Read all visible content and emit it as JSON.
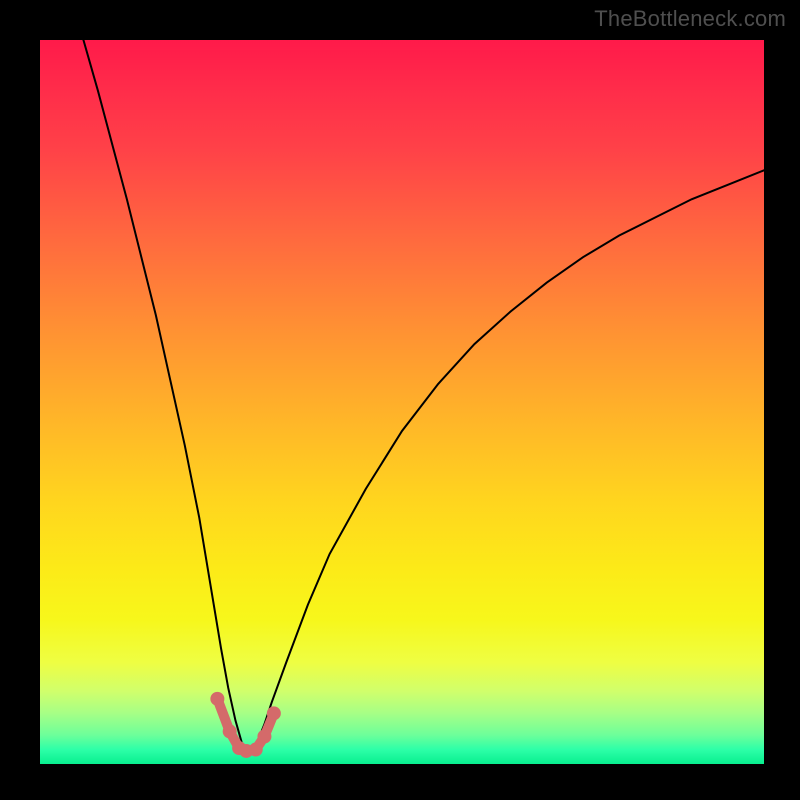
{
  "watermark": "TheBottleneck.com",
  "colors": {
    "frame": "#000000",
    "watermark_text": "#4f4f4f",
    "curve_stroke": "#000000",
    "dot_fill": "#d46a6a",
    "gradient_stops": [
      "#ff1a4a",
      "#ff2a4a",
      "#ff4148",
      "#ff6b3e",
      "#ff9133",
      "#ffb728",
      "#ffd61e",
      "#fcea18",
      "#f7f71b",
      "#eefe43",
      "#d0ff6c",
      "#a6ff86",
      "#6dff9a",
      "#2dffa8",
      "#08ef8f"
    ]
  },
  "chart_data": {
    "type": "line",
    "title": "",
    "xlabel": "",
    "ylabel": "",
    "xlim": [
      0,
      100
    ],
    "ylim": [
      0,
      100
    ],
    "grid": false,
    "legend": false,
    "description": "V-shaped bottleneck curve with minimum near x≈28; steep left rise, gentler right rise. Background vertical gradient encodes severity (red=high, green=low).",
    "series": [
      {
        "name": "bottleneck-curve",
        "x": [
          6,
          8,
          10,
          12,
          14,
          16,
          18,
          20,
          22,
          24,
          25,
          26,
          27,
          28,
          29,
          30,
          31,
          32,
          34,
          37,
          40,
          45,
          50,
          55,
          60,
          65,
          70,
          75,
          80,
          85,
          90,
          95,
          100
        ],
        "y": [
          100,
          93,
          85.5,
          78,
          70,
          62,
          53,
          44,
          34,
          22,
          16,
          10.5,
          6,
          2.5,
          2,
          3,
          5.5,
          8.5,
          14,
          22,
          29,
          38,
          46,
          52.5,
          58,
          62.5,
          66.5,
          70,
          73,
          75.5,
          78,
          80,
          82
        ]
      }
    ],
    "highlight_points": {
      "name": "near-minimum-dots",
      "x": [
        24.5,
        26.2,
        27.5,
        28.5,
        29.8,
        31.0,
        32.3
      ],
      "y": [
        9.0,
        4.5,
        2.2,
        1.8,
        2.0,
        3.8,
        7.0
      ]
    }
  }
}
